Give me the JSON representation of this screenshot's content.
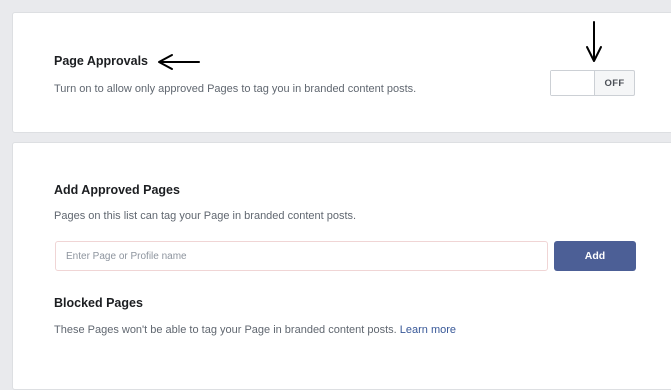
{
  "page_approvals": {
    "title": "Page Approvals",
    "description": "Turn on to allow only approved Pages to tag you in branded content posts.",
    "toggle_state": "OFF"
  },
  "add_approved": {
    "title": "Add Approved Pages",
    "description": "Pages on this list can tag your Page in branded content posts.",
    "input_placeholder": "Enter Page or Profile name",
    "input_value": "",
    "add_label": "Add"
  },
  "blocked": {
    "title": "Blocked Pages",
    "description": "These Pages won't be able to tag your Page in branded content posts.",
    "link": "Learn more"
  },
  "colors": {
    "accent_button": "#4c5f96",
    "link": "#385898",
    "annotation_arrow": "#000000"
  },
  "icons": {
    "annotation_left": "arrow-left-icon",
    "annotation_down": "arrow-down-icon"
  }
}
